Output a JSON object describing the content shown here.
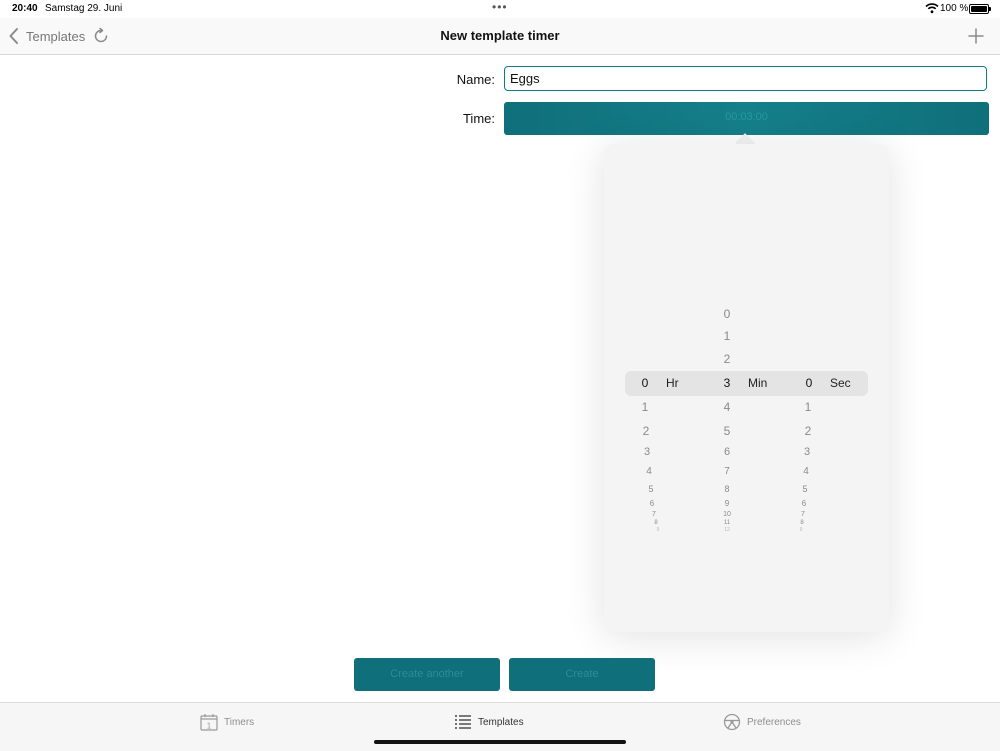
{
  "status_bar": {
    "time": "20:40",
    "date": "Samstag 29. Juni",
    "battery": "100 %"
  },
  "nav": {
    "back_label": "Templates",
    "title": "New template timer",
    "back_icon": "chevron-left-icon",
    "refresh_icon": "refresh-icon",
    "add_icon": "plus-icon"
  },
  "form": {
    "name_label": "Name:",
    "name_value": "Eggs",
    "time_label": "Time:",
    "time_button_label": "00:03:00"
  },
  "picker": {
    "hours": {
      "unit": "Hr",
      "selected": "0",
      "below": [
        "1",
        "2",
        "3",
        "4",
        "5",
        "6",
        "7",
        "8",
        "9"
      ]
    },
    "minutes": {
      "unit": "Min",
      "selected": "3",
      "above": [
        "0",
        "1",
        "2"
      ],
      "below": [
        "4",
        "5",
        "6",
        "7",
        "8",
        "9",
        "10",
        "11",
        "12"
      ]
    },
    "seconds": {
      "unit": "Sec",
      "selected": "0",
      "below": [
        "1",
        "2",
        "3",
        "4",
        "5",
        "6",
        "7",
        "8",
        "9"
      ]
    }
  },
  "actions": {
    "create_another": "Create another",
    "create": "Create"
  },
  "tabs": [
    {
      "label": "Timers",
      "icon": "calendar-icon",
      "active": false
    },
    {
      "label": "Templates",
      "icon": "list-icon",
      "active": true
    },
    {
      "label": "Preferences",
      "icon": "steering-wheel-icon",
      "active": false
    }
  ],
  "colors": {
    "accent": "#0f6f7a",
    "input_border": "#0e7c86"
  }
}
